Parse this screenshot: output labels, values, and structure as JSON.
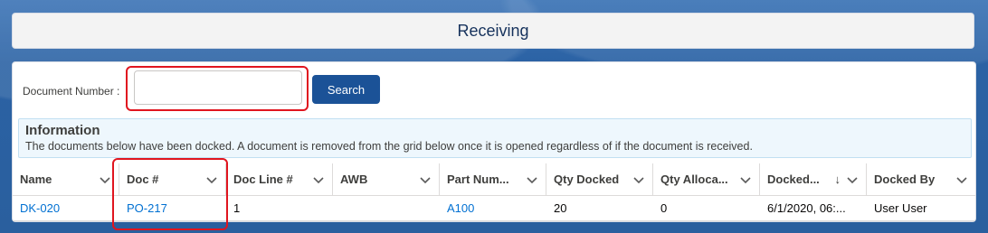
{
  "header": {
    "title": "Receiving"
  },
  "search": {
    "label": "Document Number :",
    "value": "",
    "placeholder": "",
    "button_label": "Search"
  },
  "info": {
    "title": "Information",
    "text": "The documents below have been docked. A document is removed from the grid below once it is opened regardless of if the document is received."
  },
  "grid": {
    "columns": [
      {
        "label": "Name"
      },
      {
        "label": "Doc #"
      },
      {
        "label": "Doc Line #"
      },
      {
        "label": "AWB"
      },
      {
        "label": "Part Num..."
      },
      {
        "label": "Qty Docked"
      },
      {
        "label": "Qty Alloca..."
      },
      {
        "label": "Docked...",
        "sort": "descending"
      },
      {
        "label": "Docked By"
      }
    ],
    "rows": [
      {
        "name": "DK-020",
        "doc": "PO-217",
        "doc_line": "1",
        "awb": "",
        "part_number": "A100",
        "qty_docked": "20",
        "qty_allocated": "0",
        "docked_date": "6/1/2020, 06:...",
        "docked_by": "User User"
      }
    ]
  },
  "colors": {
    "brand_button": "#1b5297",
    "link": "#0070d2",
    "highlight": "#e0151f",
    "background": "#2a5f9e"
  }
}
